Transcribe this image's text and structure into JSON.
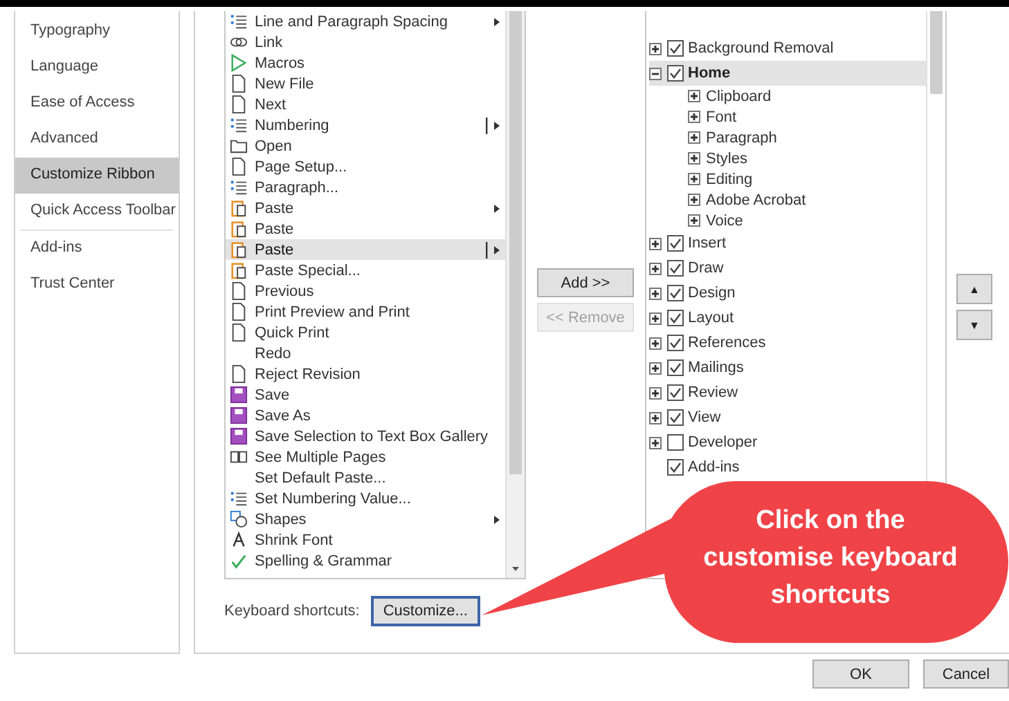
{
  "nav": [
    {
      "label": "Typography",
      "selected": false
    },
    {
      "label": "Language",
      "selected": false
    },
    {
      "label": "Ease of Access",
      "selected": false
    },
    {
      "label": "Advanced",
      "selected": false
    },
    {
      "label": "Customize Ribbon",
      "selected": true
    },
    {
      "label": "Quick Access Toolbar",
      "selected": false
    },
    {
      "label": "Add-ins",
      "selected": false
    },
    {
      "label": "Trust Center",
      "selected": false
    }
  ],
  "commands": [
    {
      "label": "Line and Paragraph Spacing",
      "selected": false,
      "submenu": true,
      "split": false
    },
    {
      "label": "Link",
      "selected": false,
      "submenu": false
    },
    {
      "label": "Macros",
      "selected": false,
      "submenu": false
    },
    {
      "label": "New File",
      "selected": false,
      "submenu": false
    },
    {
      "label": "Next",
      "selected": false,
      "submenu": false
    },
    {
      "label": "Numbering",
      "selected": false,
      "submenu": true,
      "split": true
    },
    {
      "label": "Open",
      "selected": false,
      "submenu": false
    },
    {
      "label": "Page Setup...",
      "selected": false,
      "submenu": false
    },
    {
      "label": "Paragraph...",
      "selected": false,
      "submenu": false
    },
    {
      "label": "Paste",
      "selected": false,
      "submenu": true,
      "split": false
    },
    {
      "label": "Paste",
      "selected": false,
      "submenu": false
    },
    {
      "label": "Paste",
      "selected": true,
      "submenu": true,
      "split": true
    },
    {
      "label": "Paste Special...",
      "selected": false,
      "submenu": false
    },
    {
      "label": "Previous",
      "selected": false,
      "submenu": false
    },
    {
      "label": "Print Preview and Print",
      "selected": false,
      "submenu": false
    },
    {
      "label": "Quick Print",
      "selected": false,
      "submenu": false
    },
    {
      "label": "Redo",
      "selected": false,
      "submenu": false
    },
    {
      "label": "Reject Revision",
      "selected": false,
      "submenu": false
    },
    {
      "label": "Save",
      "selected": false,
      "submenu": false
    },
    {
      "label": "Save As",
      "selected": false,
      "submenu": false
    },
    {
      "label": "Save Selection to Text Box Gallery",
      "selected": false,
      "submenu": false
    },
    {
      "label": "See Multiple Pages",
      "selected": false,
      "submenu": false
    },
    {
      "label": "Set Default Paste...",
      "selected": false,
      "submenu": false
    },
    {
      "label": "Set Numbering Value...",
      "selected": false,
      "submenu": false
    },
    {
      "label": "Shapes",
      "selected": false,
      "submenu": true,
      "split": false
    },
    {
      "label": "Shrink Font",
      "selected": false,
      "submenu": false
    },
    {
      "label": "Spelling & Grammar",
      "selected": false,
      "submenu": false
    }
  ],
  "add_button": {
    "label": "Add >>",
    "disabled": false
  },
  "remove_button": {
    "label": "<< Remove",
    "disabled": true
  },
  "tabs_tree": [
    {
      "label": "Background Removal",
      "checked": true,
      "selected": false
    },
    {
      "label": "Home",
      "checked": true,
      "expanded": true,
      "selected": true,
      "children": [
        {
          "label": "Clipboard"
        },
        {
          "label": "Font"
        },
        {
          "label": "Paragraph"
        },
        {
          "label": "Styles"
        },
        {
          "label": "Editing"
        },
        {
          "label": "Adobe Acrobat"
        },
        {
          "label": "Voice"
        }
      ]
    },
    {
      "label": "Insert",
      "checked": true,
      "selected": false
    },
    {
      "label": "Draw",
      "checked": true,
      "selected": false
    },
    {
      "label": "Design",
      "checked": true,
      "selected": false
    },
    {
      "label": "Layout",
      "checked": true,
      "selected": false
    },
    {
      "label": "References",
      "checked": true,
      "selected": false
    },
    {
      "label": "Mailings",
      "checked": true,
      "selected": false
    },
    {
      "label": "Review",
      "checked": true,
      "selected": false
    },
    {
      "label": "View",
      "checked": true,
      "selected": false
    },
    {
      "label": "Developer",
      "checked": false,
      "selected": false
    },
    {
      "label": "Add-ins",
      "checked": true,
      "expandable": false,
      "selected": false
    }
  ],
  "move_up": "▲",
  "move_down": "▼",
  "keyboard_shortcuts": {
    "label": "Keyboard shortcuts:",
    "button": "Customize..."
  },
  "callout": "Click on the customise keyboard shortcuts",
  "footer_buttons": [
    "OK",
    "Cancel"
  ]
}
